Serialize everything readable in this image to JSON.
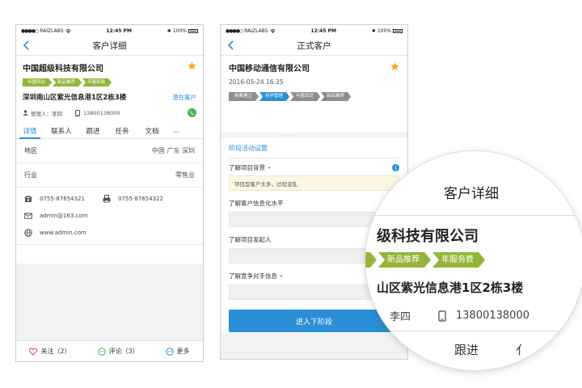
{
  "statusbar": {
    "carrier": "RAIZLABS",
    "time": "12:45 PM",
    "battery": "100%"
  },
  "left": {
    "nav_title": "客户详细",
    "company": "中国超级科技有限公司",
    "pipeline": [
      "年度回访",
      "新品推荐",
      "年服务费"
    ],
    "address": "深圳南山区紫光信息港1区2栋3楼",
    "potential_label": "潜在客户",
    "manager": "管理人：李四",
    "phone": "13800138000",
    "tabs": [
      "详情",
      "联系人",
      "跟进",
      "任务",
      "文档",
      "..."
    ],
    "region_label": "地区",
    "region_value": "中国 广东 深圳",
    "industry_label": "行业",
    "industry_value": "零售业",
    "tel": "0755-87654321",
    "fax": "0755-87654322",
    "email": "admin@163.com",
    "website": "www.admin.com",
    "bottom": {
      "follow": "关注（2）",
      "comment": "评论（3）",
      "more": "更多"
    }
  },
  "right": {
    "nav_title": "正式客户",
    "company": "中国移动通信有限公司",
    "date": "2016-05-24 16:25",
    "stages": [
      "档案建立",
      "科学管理",
      "年度回访",
      "新品推荐"
    ],
    "section_title": "阶段活动设置",
    "q1_label": "了解项目背景",
    "q1_note": "项目型客户太多，过程混乱",
    "q2_label": "了解客户信息化水平",
    "q3_label": "了解项目发起人",
    "q4_label": "了解竞争对手信息",
    "next_button": "进入下阶段"
  },
  "magnifier": {
    "title": "客户详细",
    "company": "级科技有限公司",
    "chips": [
      "新品推荐",
      "年服务费"
    ],
    "address": "山区紫光信息港1区2栋3楼",
    "manager": "李四",
    "phone": "13800138000",
    "tab": "跟进",
    "tab_partial": "亻"
  },
  "colors": {
    "accent": "#2a8fd6",
    "green": "#94b53a",
    "star": "#f5a623",
    "required": "#e04040"
  }
}
